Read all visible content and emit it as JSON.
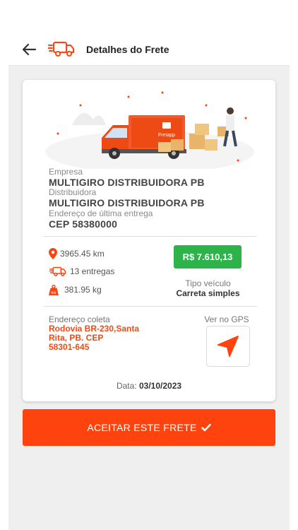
{
  "header": {
    "title": "Detalhes do Frete"
  },
  "illustration": {
    "truck_brand": "Fretapp"
  },
  "company": {
    "empresa_label": "Empresa",
    "empresa_value": "MULTIGIRO DISTRIBUIDORA PB",
    "distribuidora_label": "Distribuidora",
    "distribuidora_value": "MULTIGIRO DISTRIBUIDORA PB",
    "endereco_label": "Endereço de última entrega",
    "endereco_value": "CEP 58380000"
  },
  "stats": {
    "distance": "3965.45 km",
    "deliveries": "13 entregas",
    "weight": "381.95 kg",
    "weight_icon_text": "KG",
    "price": "R$ 7.610,13",
    "tipo_label": "Tipo veículo",
    "tipo_value": "Carreta simples"
  },
  "pickup": {
    "label": "Endereço coleta",
    "line1": "Rodovia BR-230,Santa",
    "line2": "Rita, PB. CEP",
    "line3": "58301-645",
    "gps_label": "Ver no GPS"
  },
  "date": {
    "label": "Data:",
    "value": "03/10/2023"
  },
  "action": {
    "accept_label": "ACEITAR ESTE FRETE"
  },
  "colors": {
    "accent": "#ff430f",
    "price_green": "#2eb24a",
    "pickup_text": "#ee4b14"
  },
  "icons": [
    "back-arrow-icon",
    "truck-icon",
    "location-pin-icon",
    "delivery-truck-icon",
    "weight-icon",
    "navigation-arrow-icon",
    "check-icon"
  ]
}
